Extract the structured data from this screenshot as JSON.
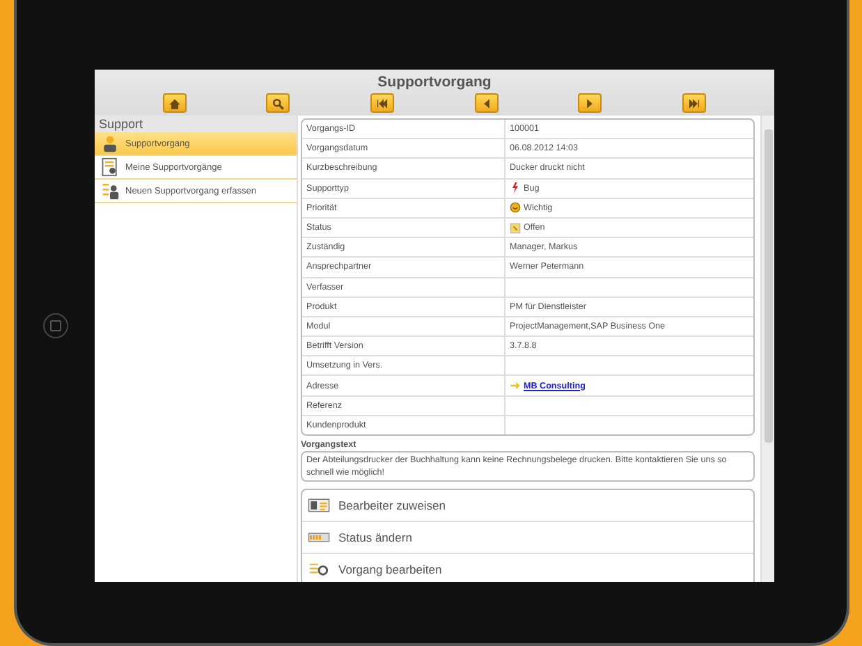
{
  "header": {
    "title": "Supportvorgang"
  },
  "toolbar": [
    {
      "kind": "home"
    },
    {
      "kind": "search"
    },
    {
      "kind": "first"
    },
    {
      "kind": "prev"
    },
    {
      "kind": "next"
    },
    {
      "kind": "last"
    }
  ],
  "sidebar": {
    "title": "Support",
    "items": [
      {
        "label": "Supportvorgang",
        "kind": "person",
        "selected": true
      },
      {
        "label": "Meine Supportvorgänge",
        "kind": "list",
        "selected": false
      },
      {
        "label": "Neuen Supportvorgang erfassen",
        "kind": "new",
        "selected": false
      }
    ]
  },
  "fields": [
    {
      "label": "Vorgangs-ID",
      "value": "100001",
      "kind": "text"
    },
    {
      "label": "Vorgangsdatum",
      "value": "06.08.2012 14:03",
      "kind": "text"
    },
    {
      "label": "Kurzbeschreibung",
      "value": "Ducker druckt nicht",
      "kind": "text"
    },
    {
      "label": "Supporttyp",
      "value": "Bug",
      "kind": "bug"
    },
    {
      "label": "Priorität",
      "value": "Wichtig",
      "kind": "priority"
    },
    {
      "label": "Status",
      "value": "Offen",
      "kind": "status"
    },
    {
      "label": "Zuständig",
      "value": "Manager, Markus",
      "kind": "text"
    },
    {
      "label": "Ansprechpartner",
      "value": "Werner Petermann",
      "kind": "text"
    },
    {
      "label": "Verfasser",
      "kind": "text"
    },
    {
      "label": "Produkt",
      "value": "PM für Dienstleister",
      "kind": "text"
    },
    {
      "label": "Modul",
      "value": "ProjectManagement,SAP Business One",
      "kind": "text"
    },
    {
      "label": "Betrifft Version",
      "value": "3.7.8.8",
      "kind": "text"
    },
    {
      "label": "Umsetzung in Vers.",
      "kind": "text"
    },
    {
      "label": "Adresse",
      "value": "MB Consulting",
      "kind": "link"
    },
    {
      "label": "Referenz",
      "kind": "text"
    },
    {
      "label": "Kundenprodukt",
      "kind": "text"
    }
  ],
  "description": {
    "label": "Vorgangstext",
    "text": "Der Abteilungsdrucker der Buchhaltung kann keine Rechnungsbelege drucken. Bitte kontaktieren Sie uns so schnell wie möglich!"
  },
  "actions": [
    {
      "label": "Bearbeiter zuweisen",
      "kind": "assign"
    },
    {
      "label": "Status ändern",
      "kind": "status"
    },
    {
      "label": "Vorgang bearbeiten",
      "kind": "edit"
    }
  ]
}
